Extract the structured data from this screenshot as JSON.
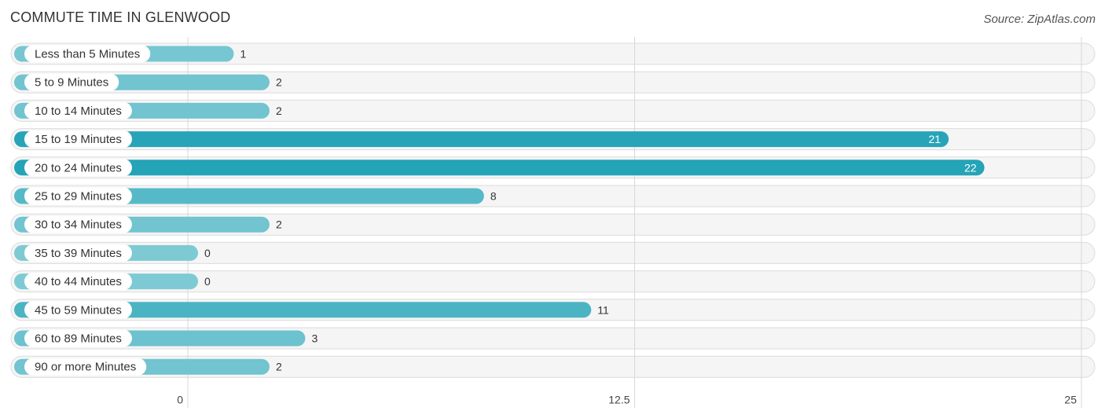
{
  "header": {
    "title": "COMMUTE TIME IN GLENWOOD",
    "source": "Source: ZipAtlas.com"
  },
  "colors": {
    "bar_low": "#7ecad4",
    "bar_high": "#25a3b7",
    "value_inside": "#ffffff",
    "value_outside": "#333333"
  },
  "chart_data": {
    "type": "bar",
    "orientation": "horizontal",
    "title": "COMMUTE TIME IN GLENWOOD",
    "xlabel": "",
    "ylabel": "",
    "categories": [
      "Less than 5 Minutes",
      "5 to 9 Minutes",
      "10 to 14 Minutes",
      "15 to 19 Minutes",
      "20 to 24 Minutes",
      "25 to 29 Minutes",
      "30 to 34 Minutes",
      "35 to 39 Minutes",
      "40 to 44 Minutes",
      "45 to 59 Minutes",
      "60 to 89 Minutes",
      "90 or more Minutes"
    ],
    "values": [
      1,
      2,
      2,
      21,
      22,
      8,
      2,
      0,
      0,
      11,
      3,
      2
    ],
    "value_labels": [
      "1",
      "2",
      "2",
      "21",
      "22",
      "8",
      "2",
      "0",
      "0",
      "11",
      "3",
      "2"
    ],
    "xlim": [
      0,
      25
    ],
    "xticks": [
      0,
      12.5,
      25
    ],
    "xtick_labels": [
      "0",
      "12.5",
      "25"
    ],
    "grid": true,
    "legend": "none"
  }
}
